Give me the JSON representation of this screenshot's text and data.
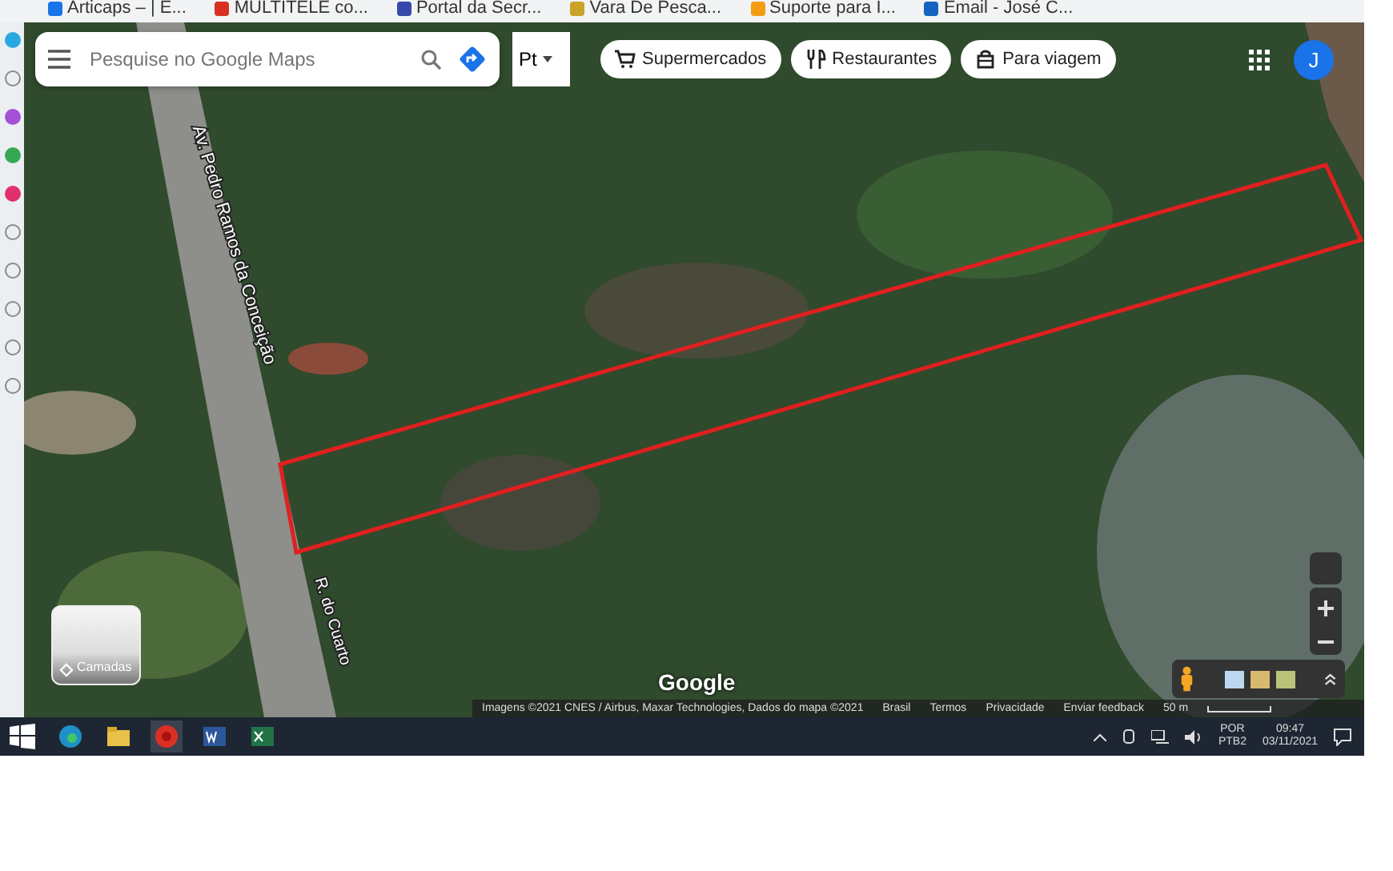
{
  "browser": {
    "bookmarks": [
      {
        "label": "Articaps – | E..."
      },
      {
        "label": "MULTITELE co..."
      },
      {
        "label": "Portal da Secr..."
      },
      {
        "label": "Vara De Pesca..."
      },
      {
        "label": "Suporte para I..."
      },
      {
        "label": "Email - José C..."
      }
    ]
  },
  "map": {
    "search": {
      "placeholder": "Pesquise no Google Maps"
    },
    "language_button": "Pt",
    "chips": [
      {
        "label": "Supermercados",
        "kind": "cart"
      },
      {
        "label": "Restaurantes",
        "kind": "food"
      },
      {
        "label": "Para viagem",
        "kind": "bag"
      }
    ],
    "account_initial": "J",
    "streets": [
      {
        "label": "Av. Pedro Ramos da Conceição",
        "kind": "avenue"
      },
      {
        "label": "R. do Cuarto",
        "kind": "street"
      }
    ],
    "layers_label": "Camadas",
    "logo": "Google",
    "attribution": [
      "Imagens ©2021 CNES / Airbus, Maxar Technologies, Dados do mapa ©2021",
      "Brasil",
      "Termos",
      "Privacidade",
      "Enviar feedback"
    ],
    "scale": "50 m"
  },
  "taskbar": {
    "language": "POR",
    "layout": "PTB2",
    "time": "09:47",
    "date": "03/11/2021"
  }
}
